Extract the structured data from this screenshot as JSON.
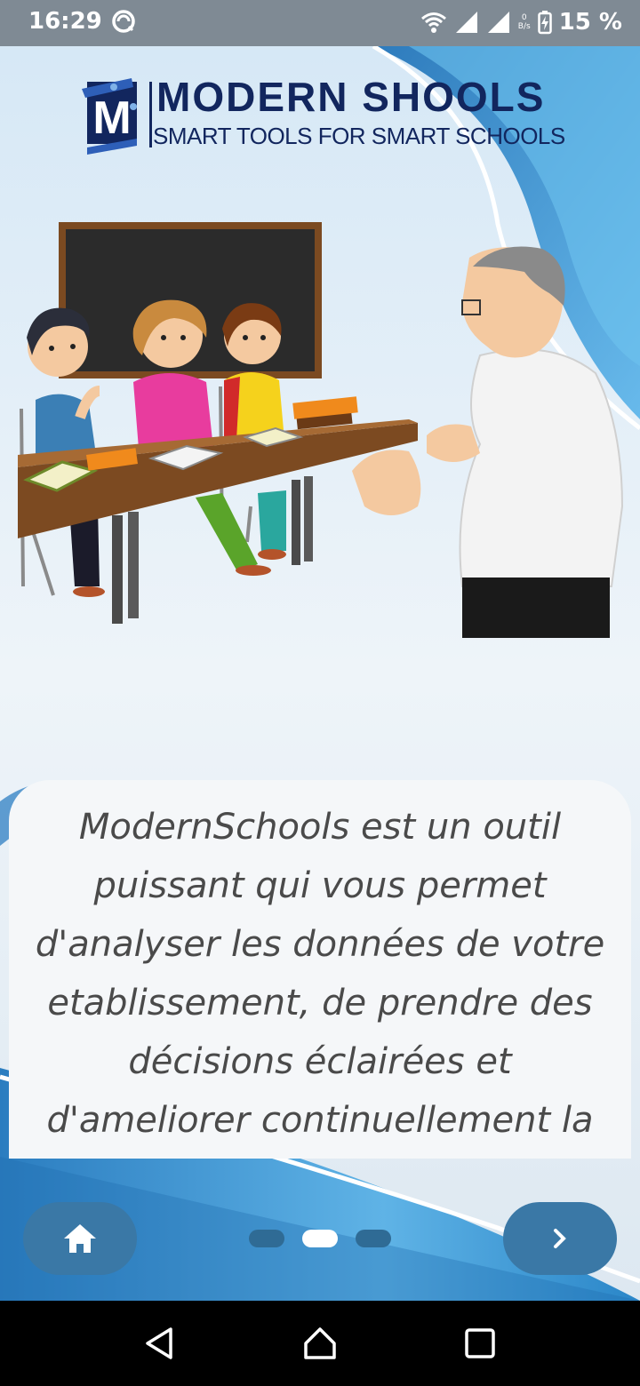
{
  "status_bar": {
    "time": "16:29",
    "battery_percent": "15 %",
    "speed_value": "0",
    "speed_unit": "B/s",
    "icons": [
      "sync-icon",
      "wifi-icon",
      "signal-icon",
      "signal-icon-2",
      "battery-icon"
    ]
  },
  "logo": {
    "title": "MODERN  SHOOLS",
    "subtitle": "SMART TOOLS FOR SMART SCHOOLS",
    "emblem_letter": "M"
  },
  "card": {
    "text": "ModernSchools est un outil puissant qui vous permet d'analyser les données de votre etablissement, de prendre des décisions éclairées et d'ameliorer continuellement la"
  },
  "controls": {
    "home_icon": "home-icon",
    "next_icon": "chevron-right-icon",
    "page_indicator": {
      "total": 3,
      "current": 2
    }
  },
  "colors": {
    "accent": "#3a78a6",
    "brand_navy": "#12265e",
    "status_bar": "#7f8a94"
  },
  "nav_bar": {
    "items": [
      "back-icon",
      "home-icon",
      "recents-icon"
    ]
  }
}
